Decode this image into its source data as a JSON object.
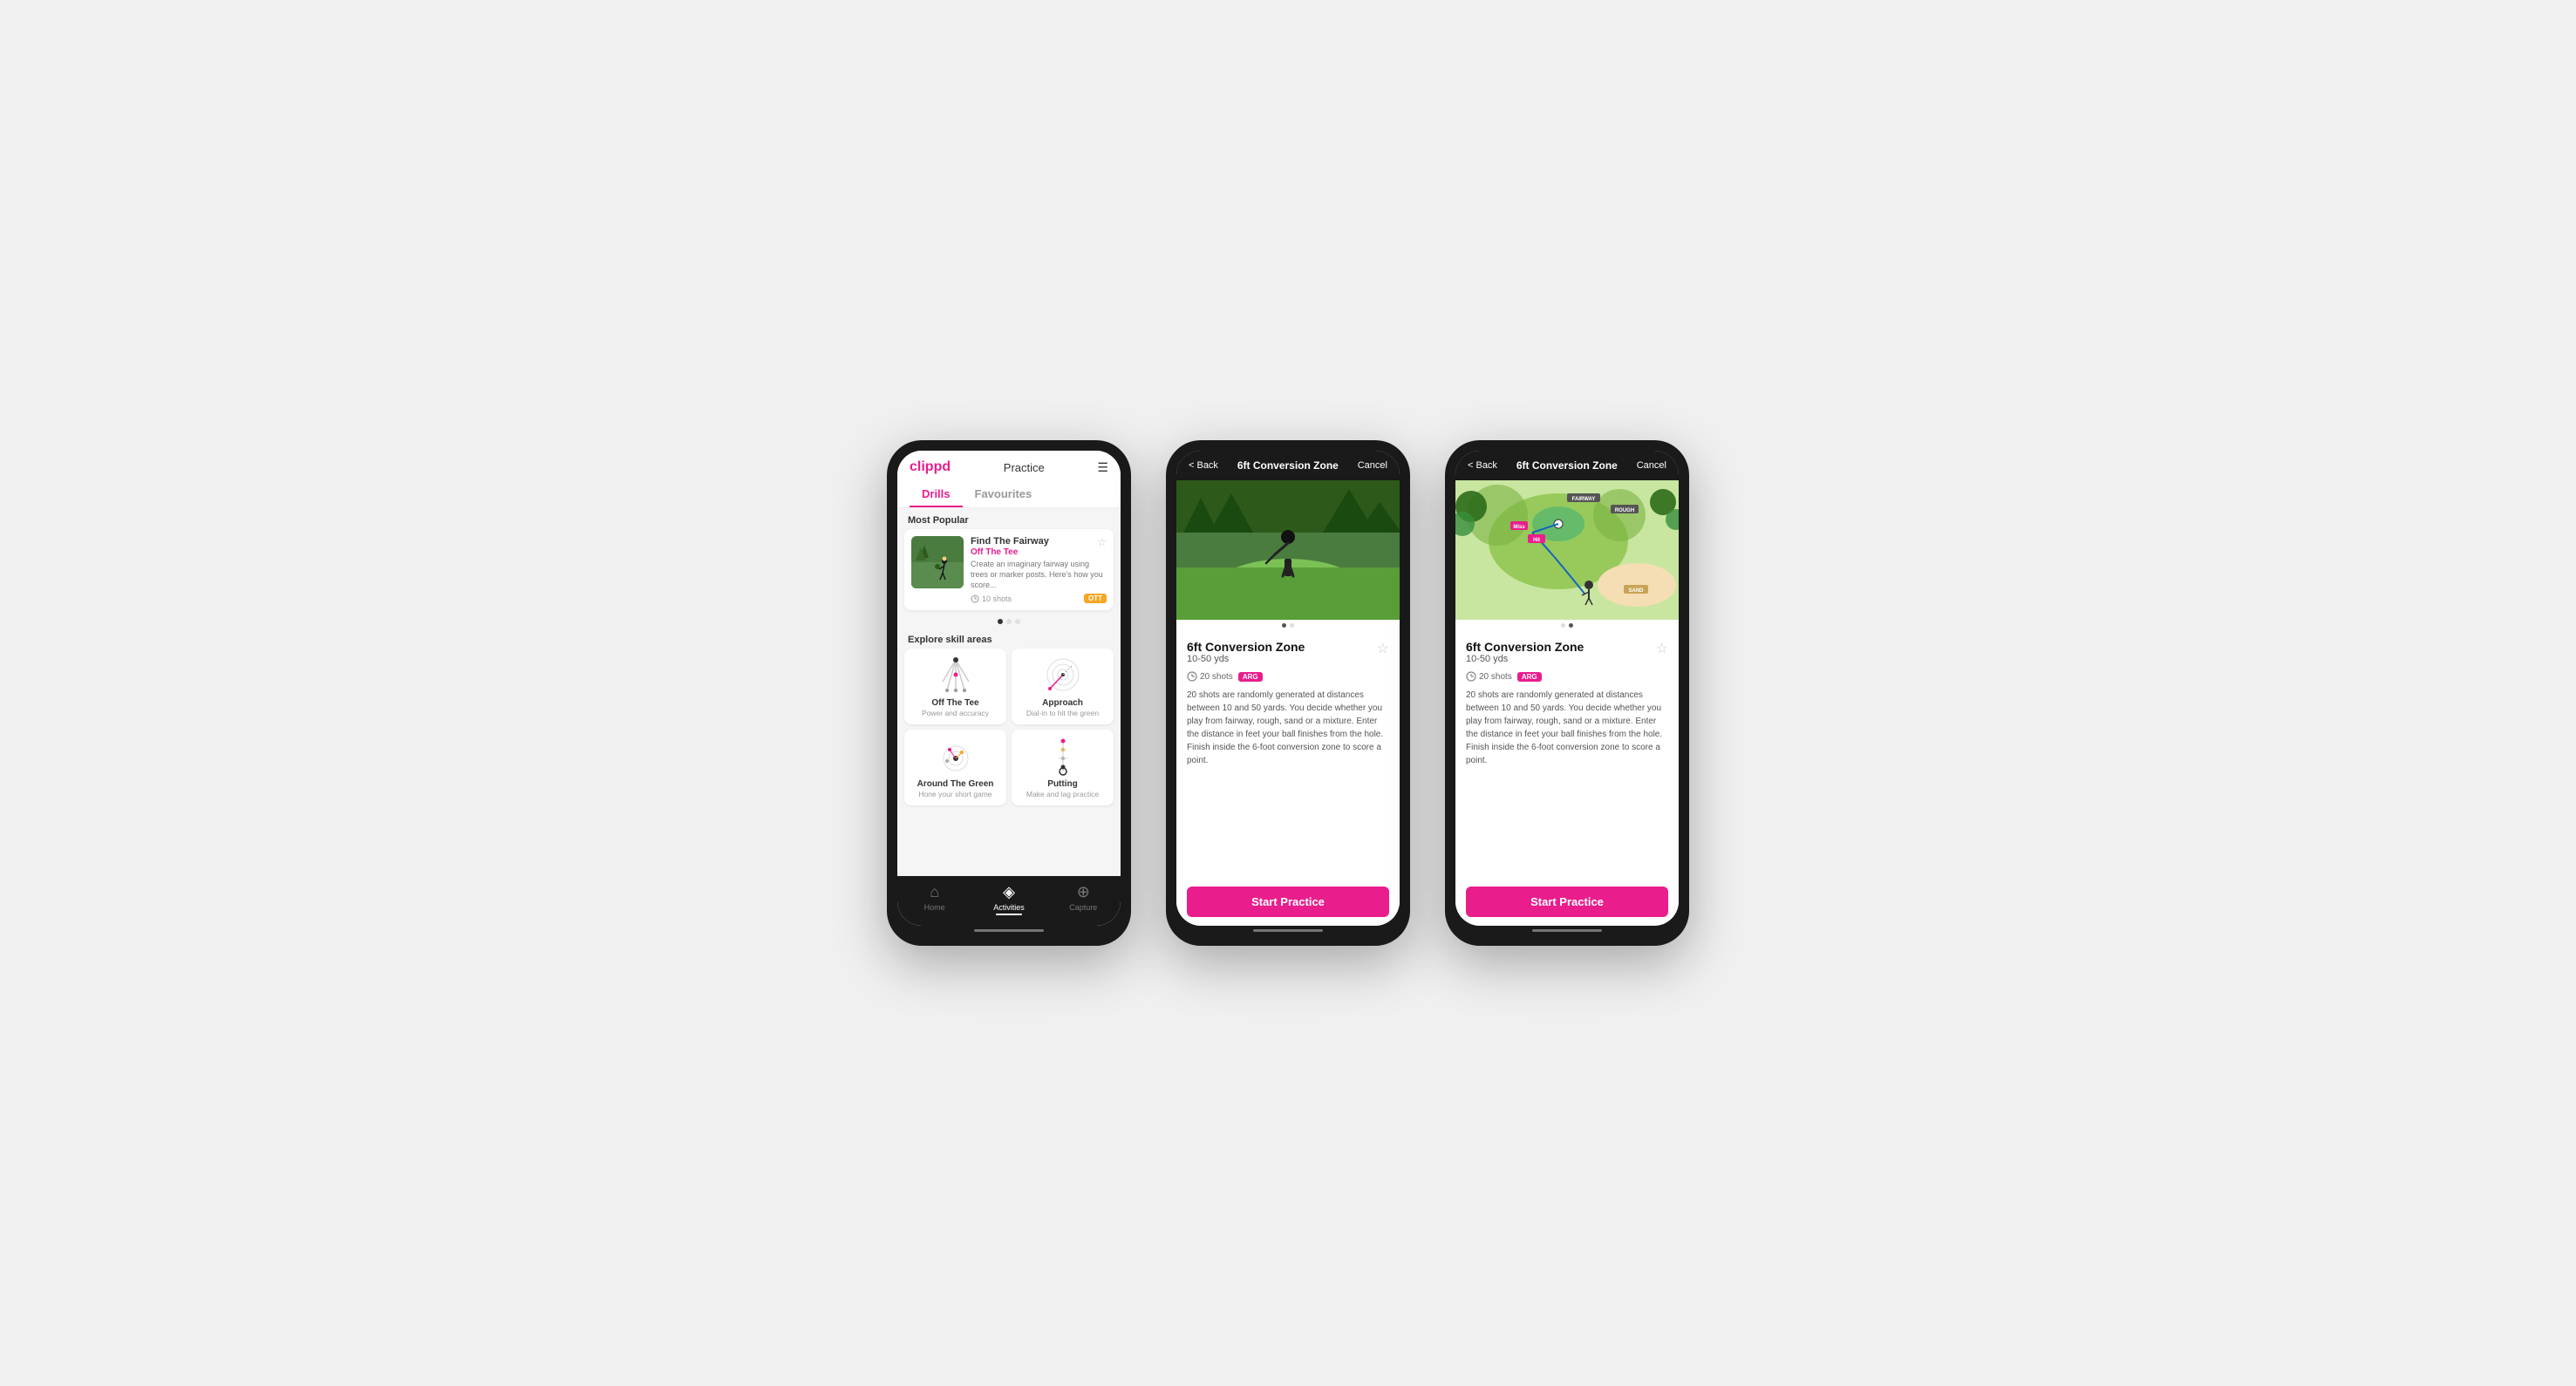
{
  "phones": {
    "phone1": {
      "header": {
        "logo": "clippd",
        "center_label": "Practice",
        "menu_icon": "☰"
      },
      "tabs": [
        {
          "label": "Drills",
          "active": true
        },
        {
          "label": "Favourites",
          "active": false
        }
      ],
      "most_popular_label": "Most Popular",
      "featured_drill": {
        "title": "Find The Fairway",
        "subtitle": "Off The Tee",
        "description": "Create an imaginary fairway using trees or marker posts. Here's how you score...",
        "shots": "10 shots",
        "badge": "OTT"
      },
      "explore_label": "Explore skill areas",
      "skill_areas": [
        {
          "name": "Off The Tee",
          "desc": "Power and accuracy"
        },
        {
          "name": "Approach",
          "desc": "Dial-in to hit the green"
        },
        {
          "name": "Around The Green",
          "desc": "Hone your short game"
        },
        {
          "name": "Putting",
          "desc": "Make and lag practice"
        }
      ],
      "nav": [
        {
          "label": "Home",
          "icon": "⌂",
          "active": false
        },
        {
          "label": "Activities",
          "icon": "◈",
          "active": true
        },
        {
          "label": "Capture",
          "icon": "⊕",
          "active": false
        }
      ]
    },
    "phone2": {
      "header": {
        "back": "< Back",
        "title": "6ft Conversion Zone",
        "cancel": "Cancel"
      },
      "image_type": "photo",
      "drill": {
        "title": "6ft Conversion Zone",
        "range": "10-50 yds",
        "shots": "20 shots",
        "badge": "ARG",
        "description": "20 shots are randomly generated at distances between 10 and 50 yards. You decide whether you play from fairway, rough, sand or a mixture. Enter the distance in feet your ball finishes from the hole. Finish inside the 6-foot conversion zone to score a point."
      },
      "start_button": "Start Practice"
    },
    "phone3": {
      "header": {
        "back": "< Back",
        "title": "6ft Conversion Zone",
        "cancel": "Cancel"
      },
      "image_type": "map",
      "drill": {
        "title": "6ft Conversion Zone",
        "range": "10-50 yds",
        "shots": "20 shots",
        "badge": "ARG",
        "description": "20 shots are randomly generated at distances between 10 and 50 yards. You decide whether you play from fairway, rough, sand or a mixture. Enter the distance in feet your ball finishes from the hole. Finish inside the 6-foot conversion zone to score a point."
      },
      "start_button": "Start Practice"
    }
  }
}
